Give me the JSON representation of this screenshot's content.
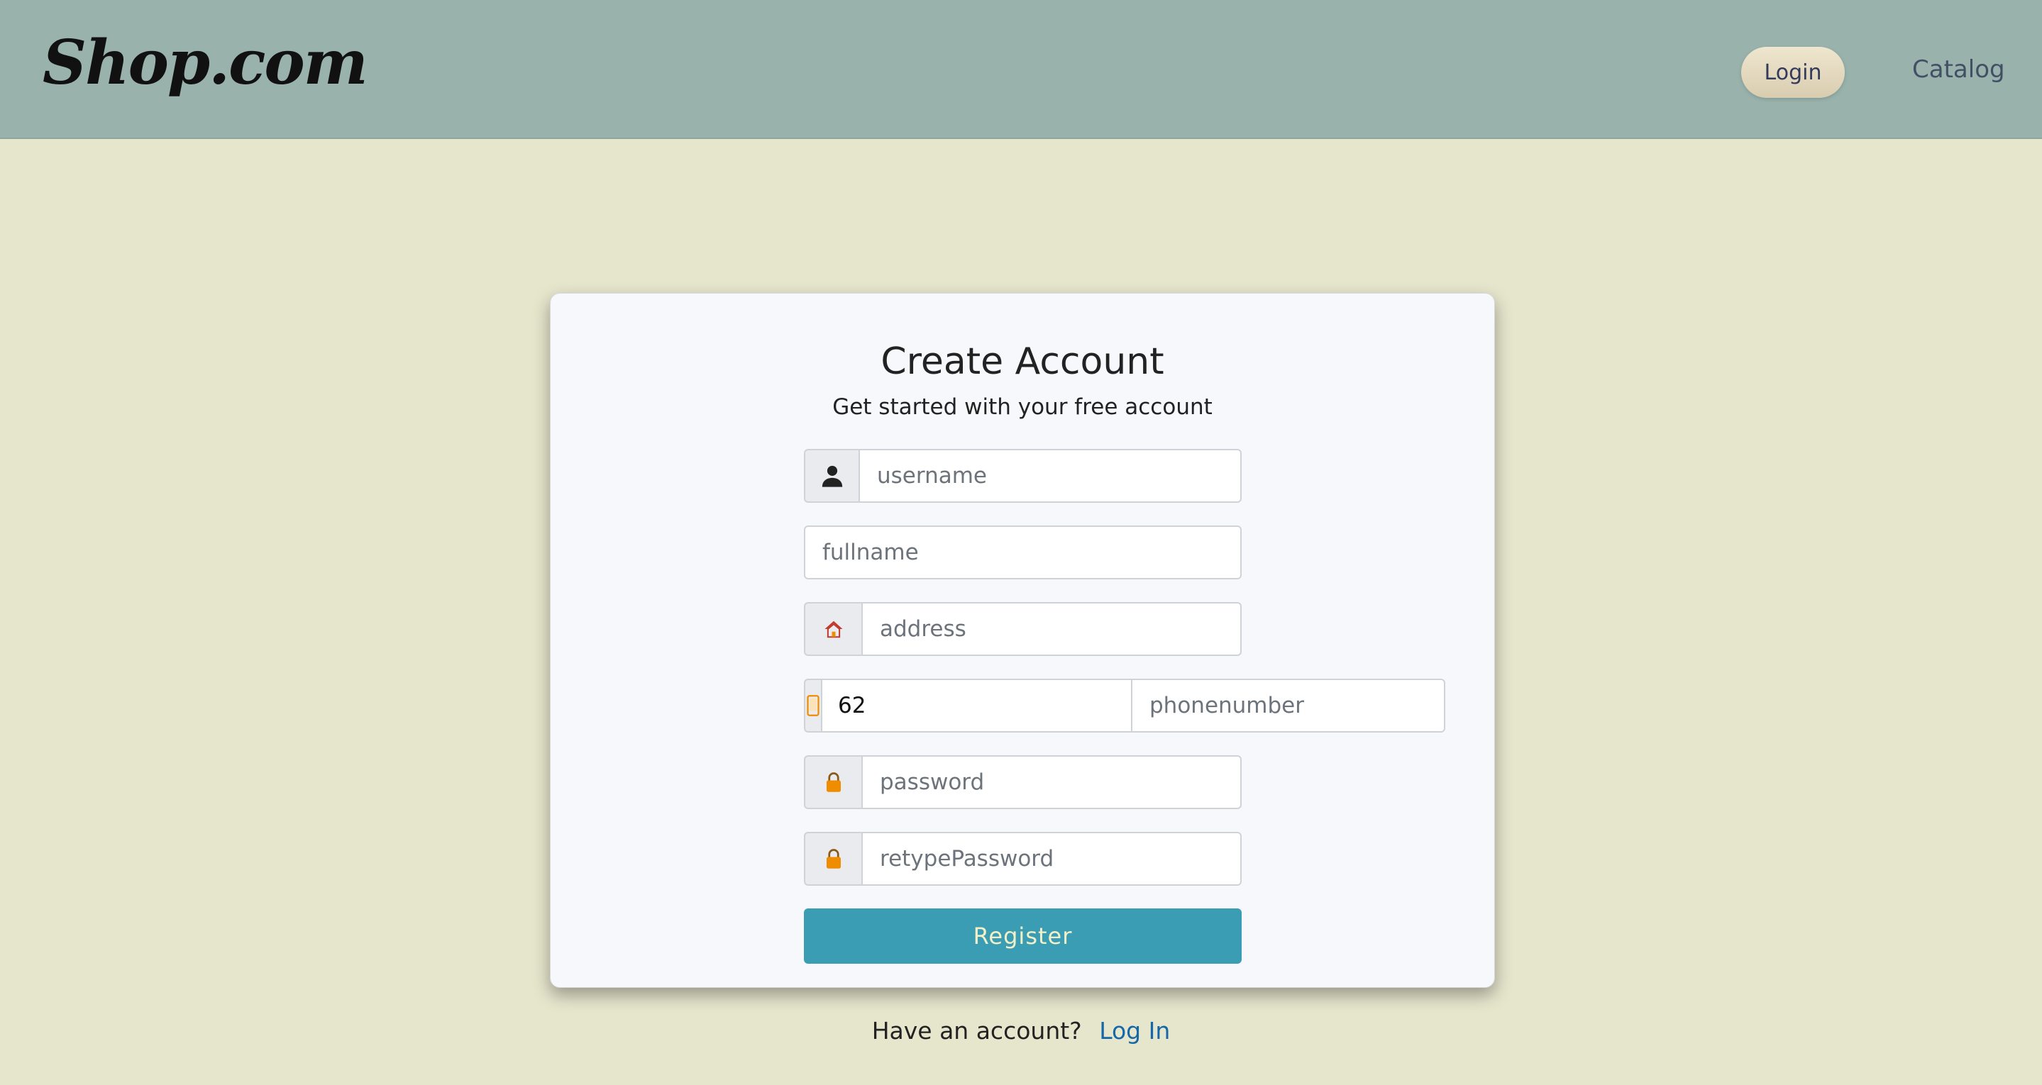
{
  "header": {
    "brand": "Shop.com",
    "login_label": "Login",
    "catalog_label": "Catalog"
  },
  "form": {
    "title": "Create Account",
    "subtitle": "Get started with your free account",
    "fields": {
      "username": {
        "placeholder": "username",
        "icon": "user-icon"
      },
      "fullname": {
        "placeholder": "fullname"
      },
      "address": {
        "placeholder": "address",
        "icon": "home-icon"
      },
      "phone": {
        "code_value": "62",
        "placeholder": "phonenumber",
        "icon": "phone-icon"
      },
      "password": {
        "placeholder": "password",
        "icon": "lock-icon"
      },
      "retype_password": {
        "placeholder": "retypePassword",
        "icon": "lock-icon"
      }
    },
    "register_label": "Register"
  },
  "footer": {
    "prompt": "Have an account?",
    "link_label": "Log In"
  },
  "colors": {
    "navbar": "#99b3ac",
    "background": "#e6e6cd",
    "register_button": "#3a9db4",
    "link": "#1467a8",
    "icon_orange": "#f08c00",
    "icon_red": "#c0392b"
  }
}
